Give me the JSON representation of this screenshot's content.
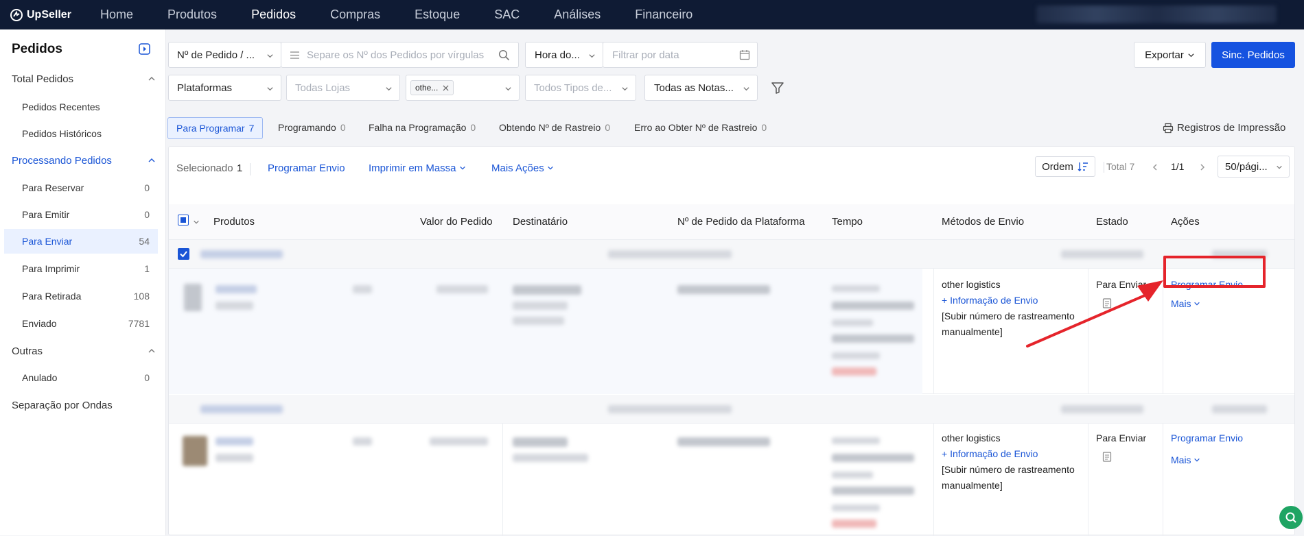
{
  "app": {
    "brand": "UpSeller"
  },
  "nav": {
    "items": [
      "Home",
      "Produtos",
      "Pedidos",
      "Compras",
      "Estoque",
      "SAC",
      "Análises",
      "Financeiro"
    ],
    "active": "Pedidos"
  },
  "sidebar": {
    "title": "Pedidos",
    "groups": {
      "total": "Total Pedidos",
      "processando": "Processando Pedidos",
      "outras": "Outras",
      "ondas": "Separação por Ondas"
    },
    "total_items": [
      "Pedidos Recentes",
      "Pedidos Históricos"
    ],
    "proc_items": [
      {
        "label": "Para Reservar",
        "count": "0"
      },
      {
        "label": "Para Emitir",
        "count": "0"
      },
      {
        "label": "Para Enviar",
        "count": "54"
      },
      {
        "label": "Para Imprimir",
        "count": "1"
      },
      {
        "label": "Para Retirada",
        "count": "108"
      },
      {
        "label": "Enviado",
        "count": "7781"
      }
    ],
    "outras_items": [
      {
        "label": "Anulado",
        "count": "0"
      }
    ]
  },
  "filters": {
    "order_type": "Nº de Pedido / ...",
    "order_search_placeholder": "Separe os Nº dos Pedidos por vírgulas",
    "time_type": "Hora do...",
    "date_placeholder": "Filtrar por data",
    "platforms": "Plataformas",
    "stores_placeholder": "Todas Lojas",
    "logistics_tag": "othe...",
    "types_placeholder": "Todos Tipos de...",
    "notes": "Todas as Notas..."
  },
  "actions": {
    "export": "Exportar",
    "sync": "Sinc. Pedidos"
  },
  "tabs": [
    {
      "label": "Para Programar",
      "count": "7"
    },
    {
      "label": "Programando",
      "count": "0"
    },
    {
      "label": "Falha na Programação",
      "count": "0"
    },
    {
      "label": "Obtendo Nº de Rastreio",
      "count": "0"
    },
    {
      "label": "Erro ao Obter Nº de Rastreio",
      "count": "0"
    }
  ],
  "print_records": "Registros de Impressão",
  "toolbar": {
    "selected_label": "Selecionado",
    "selected_count": "1",
    "program": "Programar Envio",
    "print_bulk": "Imprimir em Massa",
    "more_actions": "Mais Ações",
    "order": "Ordem",
    "total": "Total 7",
    "page": "1/1",
    "page_size": "50/pági..."
  },
  "columns": [
    "Produtos",
    "Valor do Pedido",
    "Destinatário",
    "Nº de Pedido da Plataforma",
    "Tempo",
    "Métodos de Envio",
    "Estado",
    "Ações"
  ],
  "rows": [
    {
      "method": "other logistics",
      "info": "+ Informação de Envio",
      "manual": "[Subir número de rastreamento manualmente]",
      "status": "Para Enviar",
      "action": "Programar Envio",
      "more": "Mais"
    },
    {
      "method": "other logistics",
      "info": "+ Informação de Envio",
      "manual": "[Subir número de rastreamento manualmente]",
      "status": "Para Enviar",
      "action": "Programar Envio",
      "more": "Mais"
    }
  ],
  "colors": {
    "topbar": "#0f1b34",
    "primary": "#1552e0",
    "link": "#1a55d6",
    "annotation": "#e5242b"
  }
}
